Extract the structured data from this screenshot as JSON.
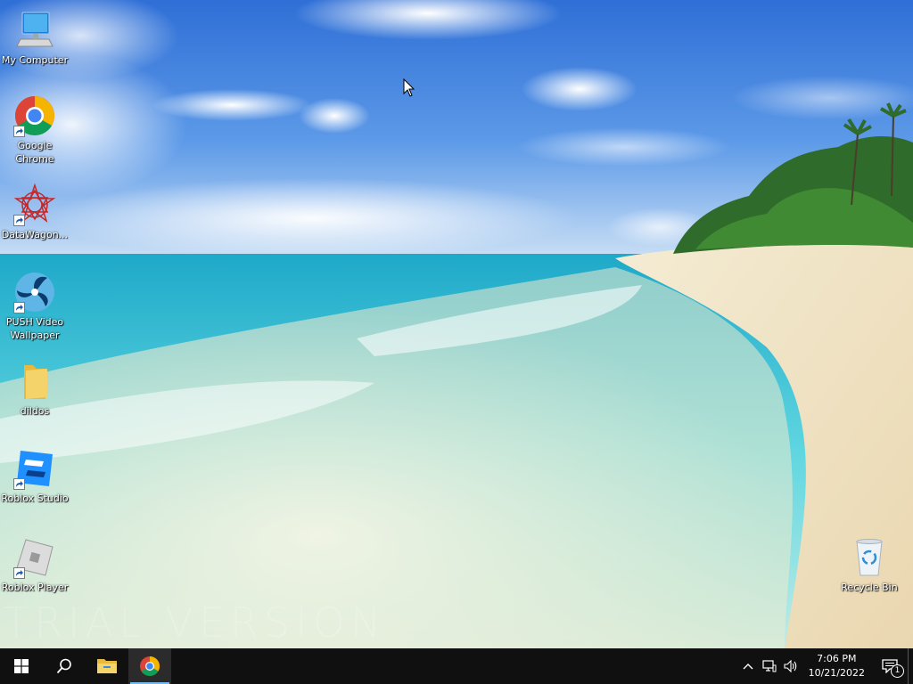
{
  "desktop": {
    "icons": [
      {
        "label": "My Computer",
        "icon": "computer-icon"
      },
      {
        "label": "Google Chrome",
        "icon": "chrome-icon"
      },
      {
        "label": "DataWagon...",
        "icon": "datawagon-icon"
      },
      {
        "label": "PUSH Video Wallpaper",
        "icon": "push-video-wallpaper-icon"
      },
      {
        "label": "dildos",
        "icon": "folder-icon"
      },
      {
        "label": "Roblox Studio",
        "icon": "roblox-studio-icon"
      },
      {
        "label": "Roblox Player",
        "icon": "roblox-player-icon"
      },
      {
        "label": "Recycle Bin",
        "icon": "recycle-bin-icon"
      }
    ],
    "watermark": "TRIAL VERSION"
  },
  "taskbar": {
    "start": "windows-start-icon",
    "search": "search-icon",
    "pinned": [
      "file-explorer-icon",
      "chrome-icon"
    ],
    "tray": {
      "icons": [
        "chevron-up-icon",
        "network-icon",
        "volume-icon"
      ],
      "time": "7:06 PM",
      "date": "10/21/2022",
      "notification_count": "1"
    }
  },
  "colors": {
    "taskbar": "#101010",
    "active_indicator": "#76b9ed"
  }
}
